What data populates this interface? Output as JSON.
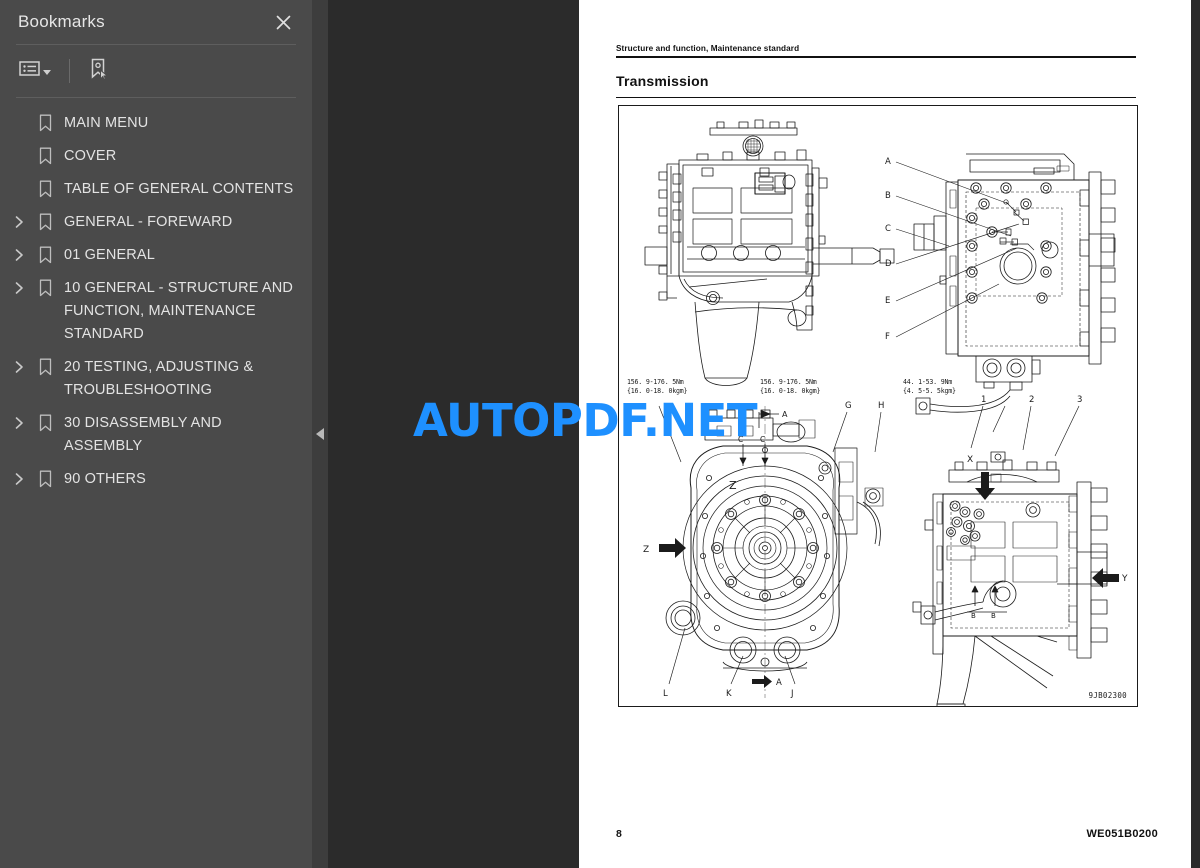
{
  "sidebar": {
    "title": "Bookmarks",
    "close_icon": "close-icon",
    "toolbar": {
      "list_options_icon": "list-options-icon",
      "new_bookmark_icon": "new-bookmark-icon"
    },
    "items": [
      {
        "label": "MAIN MENU",
        "expandable": false
      },
      {
        "label": "COVER",
        "expandable": false
      },
      {
        "label": "TABLE OF GENERAL CONTENTS",
        "expandable": false
      },
      {
        "label": "GENERAL - FOREWARD",
        "expandable": true
      },
      {
        "label": "01 GENERAL",
        "expandable": true
      },
      {
        "label": "10 GENERAL - STRUCTURE AND FUNCTION, MAINTENANCE STANDARD",
        "expandable": true
      },
      {
        "label": "20 TESTING, ADJUSTING & TROUBLESHOOTING",
        "expandable": true
      },
      {
        "label": "30 DISASSEMBLY AND ASSEMBLY",
        "expandable": true
      },
      {
        "label": "90 OTHERS",
        "expandable": true
      }
    ]
  },
  "viewer": {
    "collapse_handle_icon": "collapse-left-icon",
    "watermark": "AUTOPDF.NET",
    "watermark_color": "#1e90ff"
  },
  "document": {
    "header": "Structure and function, Maintenance standard",
    "title": "Transmission",
    "figure_code": "9JB02300",
    "page_number": "8",
    "doc_code": "WE051B0200",
    "torque_notes": [
      {
        "line1": "156. 9-176. 5Nm",
        "line2": "{16. 0-18. 0kgm}"
      },
      {
        "line1": "156. 9-176. 5Nm",
        "line2": "{16. 0-18. 0kgm}"
      },
      {
        "line1": "44. 1-53. 9Nm",
        "line2": "{4. 5-5. 5kgm}"
      }
    ],
    "callouts": {
      "top_right_letters": [
        "A",
        "B",
        "C",
        "D",
        "E",
        "F"
      ],
      "mid_letters": [
        "Z",
        "G",
        "H"
      ],
      "numbers": [
        "1",
        "2",
        "3"
      ],
      "section_arrows": [
        "Z",
        "Y",
        "X",
        "A",
        "B",
        "C"
      ],
      "bottom_letters": [
        "L",
        "K",
        "J",
        "A"
      ]
    }
  }
}
